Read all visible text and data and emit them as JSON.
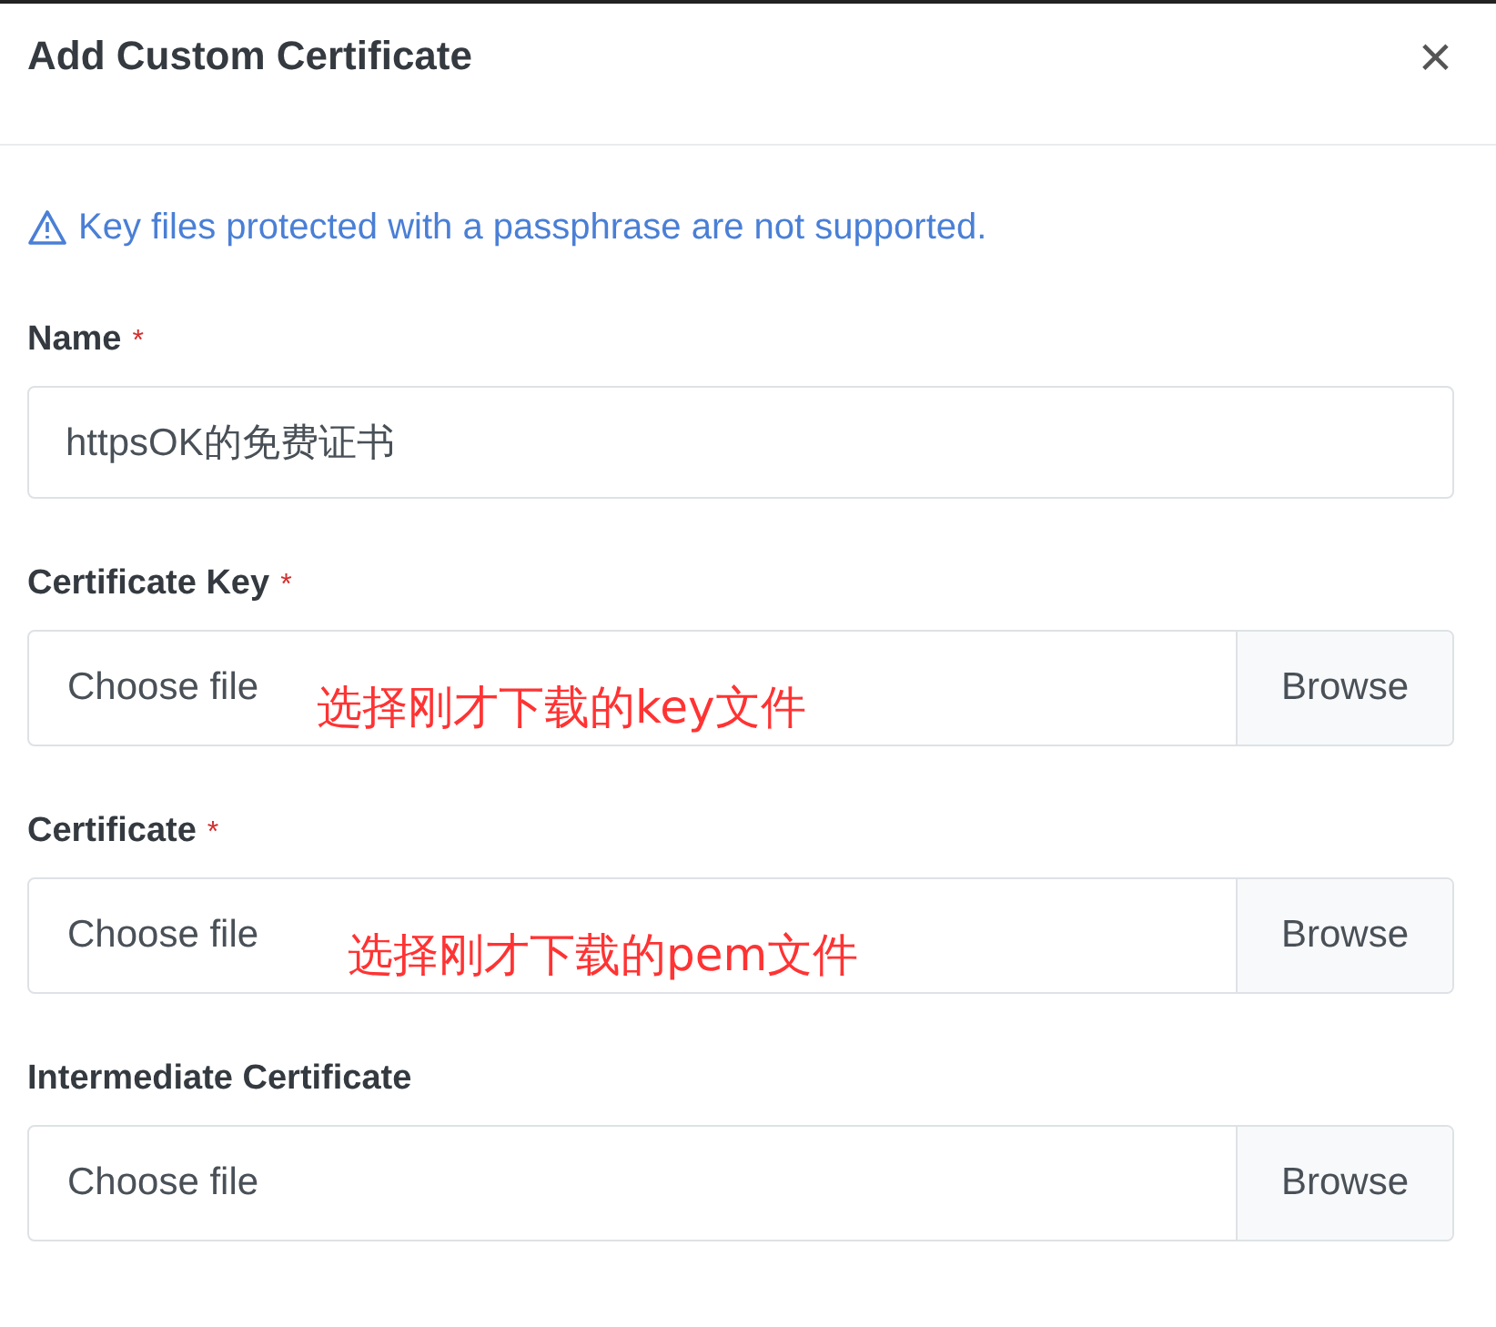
{
  "dialog": {
    "title": "Add Custom Certificate",
    "close_label": "×"
  },
  "warning": "Key files protected with a passphrase are not supported.",
  "fields": [
    {
      "kind": "text",
      "label": "Name",
      "required_mark": "*",
      "value": "httpsOK的免费证书"
    },
    {
      "kind": "file",
      "label": "Certificate Key",
      "required_mark": "*",
      "placeholder": "Choose file",
      "button": "Browse",
      "annotation": "选择刚才下载的key文件"
    },
    {
      "kind": "file",
      "label": "Certificate",
      "required_mark": "*",
      "placeholder": "Choose file",
      "button": "Browse",
      "annotation": "选择刚才下载的pem文件"
    },
    {
      "kind": "file",
      "label": "Intermediate Certificate",
      "placeholder": "Choose file",
      "button": "Browse"
    }
  ]
}
